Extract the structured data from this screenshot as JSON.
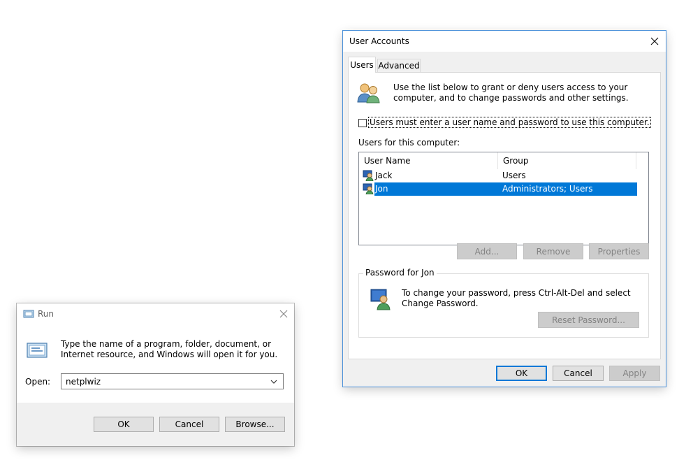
{
  "run_dialog": {
    "title": "Run",
    "description": "Type the name of a program, folder, document, or Internet resource, and Windows will open it for you.",
    "open_label": "Open:",
    "open_value": "netplwiz",
    "ok_label": "OK",
    "cancel_label": "Cancel",
    "browse_label": "Browse..."
  },
  "user_accounts": {
    "title": "User Accounts",
    "tabs": [
      {
        "label": "Users",
        "active": true
      },
      {
        "label": "Advanced",
        "active": false
      }
    ],
    "intro_text": "Use the list below to grant or deny users access to your computer, and to change passwords and other settings.",
    "require_login_checkbox": {
      "label": "Users must enter a user name and password to use this computer.",
      "checked": false
    },
    "users_list_label": "Users for this computer:",
    "columns": [
      "User Name",
      "Group"
    ],
    "rows": [
      {
        "name": "Jack",
        "group": "Users",
        "selected": false
      },
      {
        "name": "Jon",
        "group": "Administrators; Users",
        "selected": true
      }
    ],
    "add_label": "Add...",
    "remove_label": "Remove",
    "properties_label": "Properties",
    "password_group_label": "Password for Jon",
    "password_text": "To change your password, press Ctrl-Alt-Del and select Change Password.",
    "reset_password_label": "Reset Password...",
    "ok_label": "OK",
    "cancel_label": "Cancel",
    "apply_label": "Apply"
  },
  "icons": {
    "run_icon": "run-icon",
    "users_icon": "users-group-icon",
    "user_row_icon": "user-icon",
    "password_icon": "user-password-icon",
    "close_icon": "close-icon",
    "dropdown_icon": "chevron-down-icon"
  },
  "colors": {
    "selection": "#0078d7",
    "default_button_border": "#0078d7",
    "dialog_background": "#f0f0f0",
    "disabled_text": "#838383"
  }
}
